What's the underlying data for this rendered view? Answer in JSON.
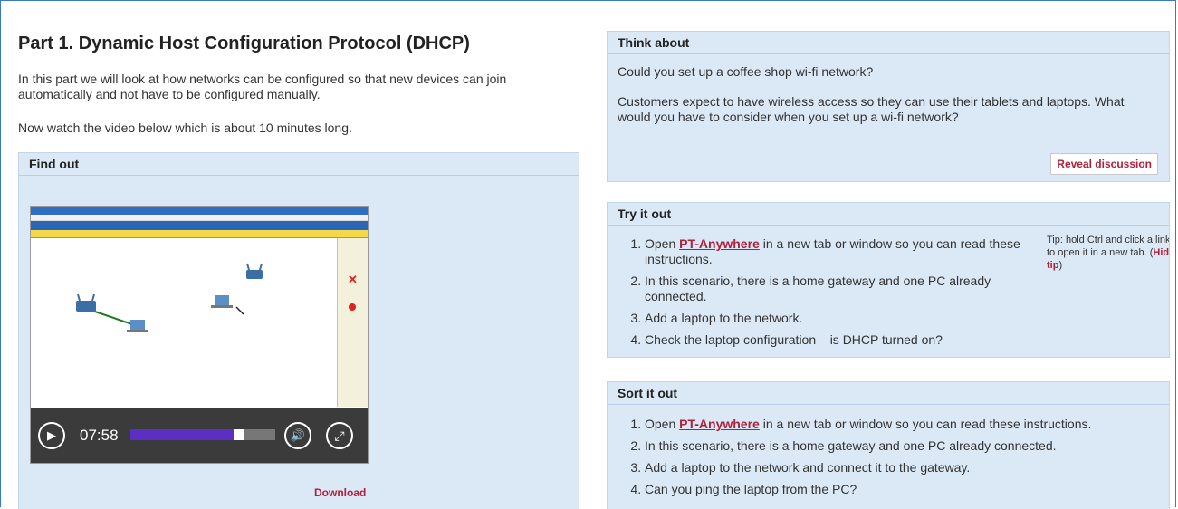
{
  "part": {
    "title": "Part 1. Dynamic Host Configuration Protocol (DHCP)",
    "intro": "In this part we will look at how networks can be configured so that new devices can join automatically and not have to be configured manually.",
    "watch": "Now watch the video below which is about 10 minutes long."
  },
  "find_out": {
    "heading": "Find out",
    "video": {
      "time": "07:58",
      "progress": 0.79
    },
    "download_label": "Download"
  },
  "think_about": {
    "heading": "Think about",
    "question": "Could you set up a coffee shop wi-fi network?",
    "body": "Customers expect to have wireless access so they can use their tablets and laptops. What would you have to consider when you set up a wi-fi network?",
    "reveal_label": "Reveal discussion"
  },
  "try_it_out": {
    "heading": "Try it out",
    "link_text": "PT-Anywhere",
    "step1_pre": "Open ",
    "step1_post": " in a new tab or window so you can read these instructions.",
    "step2": "In this scenario, there is a home gateway and one PC already connected.",
    "step3": "Add a laptop to the network.",
    "step4": "Check the laptop configuration – is DHCP turned on?",
    "tip_text": "Tip: hold Ctrl and click a link to open it in a new tab.",
    "tip_link": "Hide tip"
  },
  "sort_it_out": {
    "heading": "Sort it out",
    "link_text": "PT-Anywhere",
    "step1_pre": "Open ",
    "step1_post": " in a new tab or window so you can read these instructions.",
    "step2": "In this scenario, there is a home gateway and one PC already connected.",
    "step3": "Add a laptop to the network and connect it to the gateway.",
    "step4": "Can you ping the laptop from the PC?"
  },
  "colors": {
    "accent": "#b0203a",
    "panel": "#dbe8f6",
    "progress": "#5a2fc2"
  },
  "icons": [
    "play-icon",
    "volume-icon",
    "fullscreen-icon"
  ]
}
